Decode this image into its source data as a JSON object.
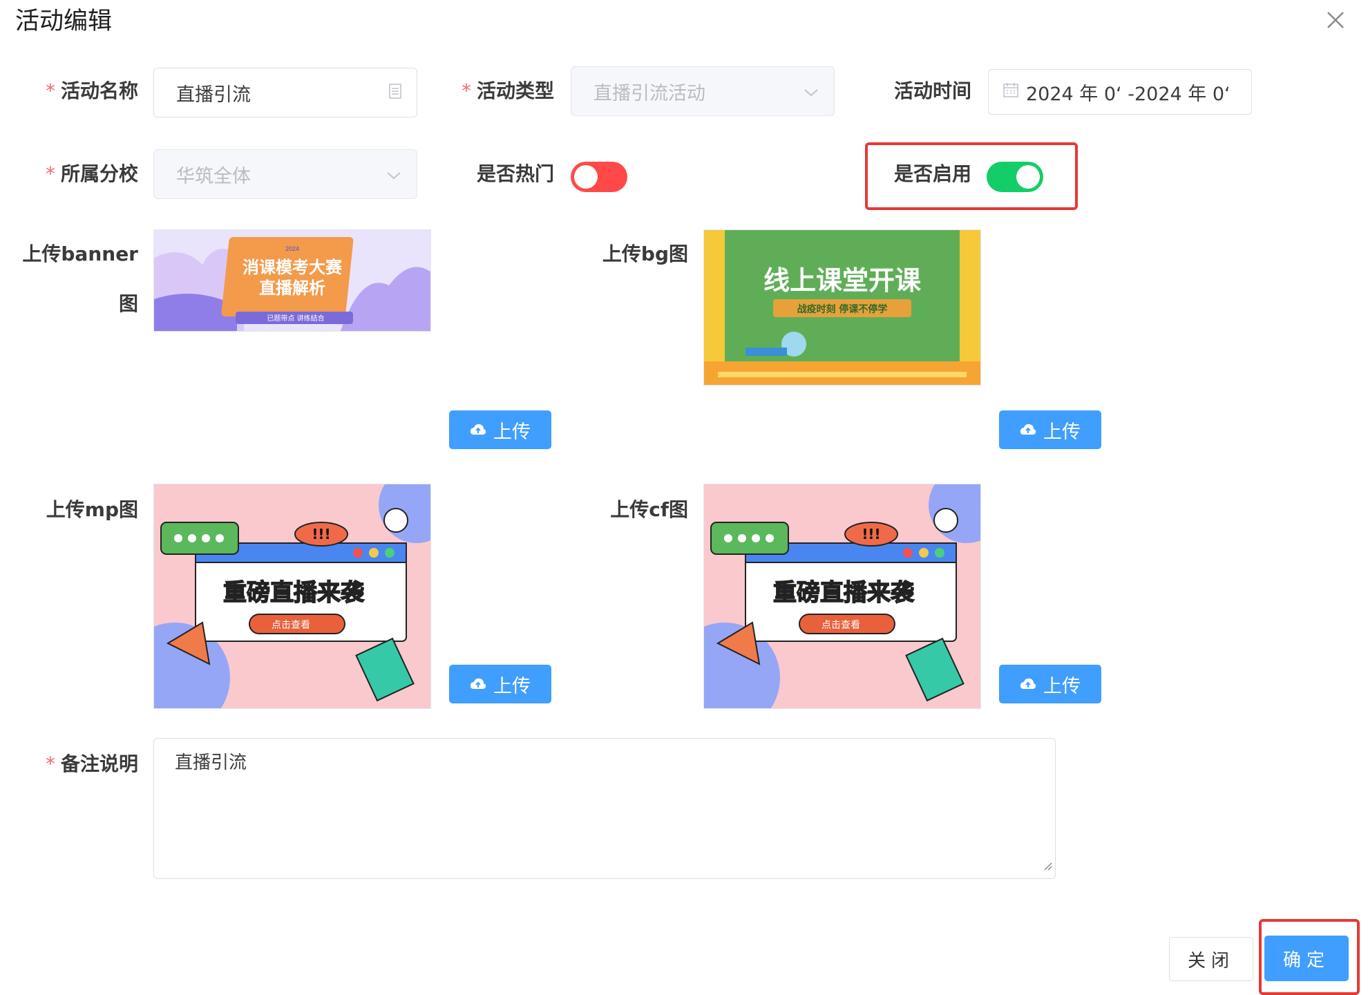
{
  "dialog": {
    "title": "活动编辑"
  },
  "form": {
    "name": {
      "label": "活动名称",
      "value": "直播引流",
      "required": "*"
    },
    "type": {
      "label": "活动类型",
      "value": "直播引流活动",
      "required": "*"
    },
    "time": {
      "label": "活动时间",
      "value": "2024 年 0‘ -2024 年 0‘"
    },
    "school": {
      "label": "所属分校",
      "value": "华筑全体",
      "required": "*"
    },
    "hot": {
      "label": "是否热门",
      "on": false
    },
    "enabled": {
      "label": "是否启用",
      "on": true
    },
    "banner": {
      "label_line1": "上传banner",
      "label_line2": "图",
      "upload_label": "上传",
      "image_text": {
        "year": "2024",
        "line1": "消课模考大赛",
        "line2": "直播解析",
        "line3": "已题带点 讲练结合"
      }
    },
    "bg": {
      "label": "上传bg图",
      "upload_label": "上传",
      "image_text": {
        "line1": "线上课堂开课",
        "line2": "战疫时刻  停课不停学"
      }
    },
    "mp": {
      "label": "上传mp图",
      "upload_label": "上传",
      "image_text": {
        "bubble": "!!!",
        "title": "重磅直播来袭",
        "button": "点击查看"
      }
    },
    "cf": {
      "label": "上传cf图",
      "upload_label": "上传",
      "image_text": {
        "bubble": "!!!",
        "title": "重磅直播来袭",
        "button": "点击查看"
      }
    },
    "remark": {
      "label": "备注说明",
      "value": "直播引流",
      "required": "*"
    }
  },
  "footer": {
    "close_label": "关闭",
    "confirm_label": "确定"
  },
  "colors": {
    "primary": "#409eff",
    "switch_off": "#ff4949",
    "switch_on": "#13ce66",
    "highlight": "#e53935"
  }
}
